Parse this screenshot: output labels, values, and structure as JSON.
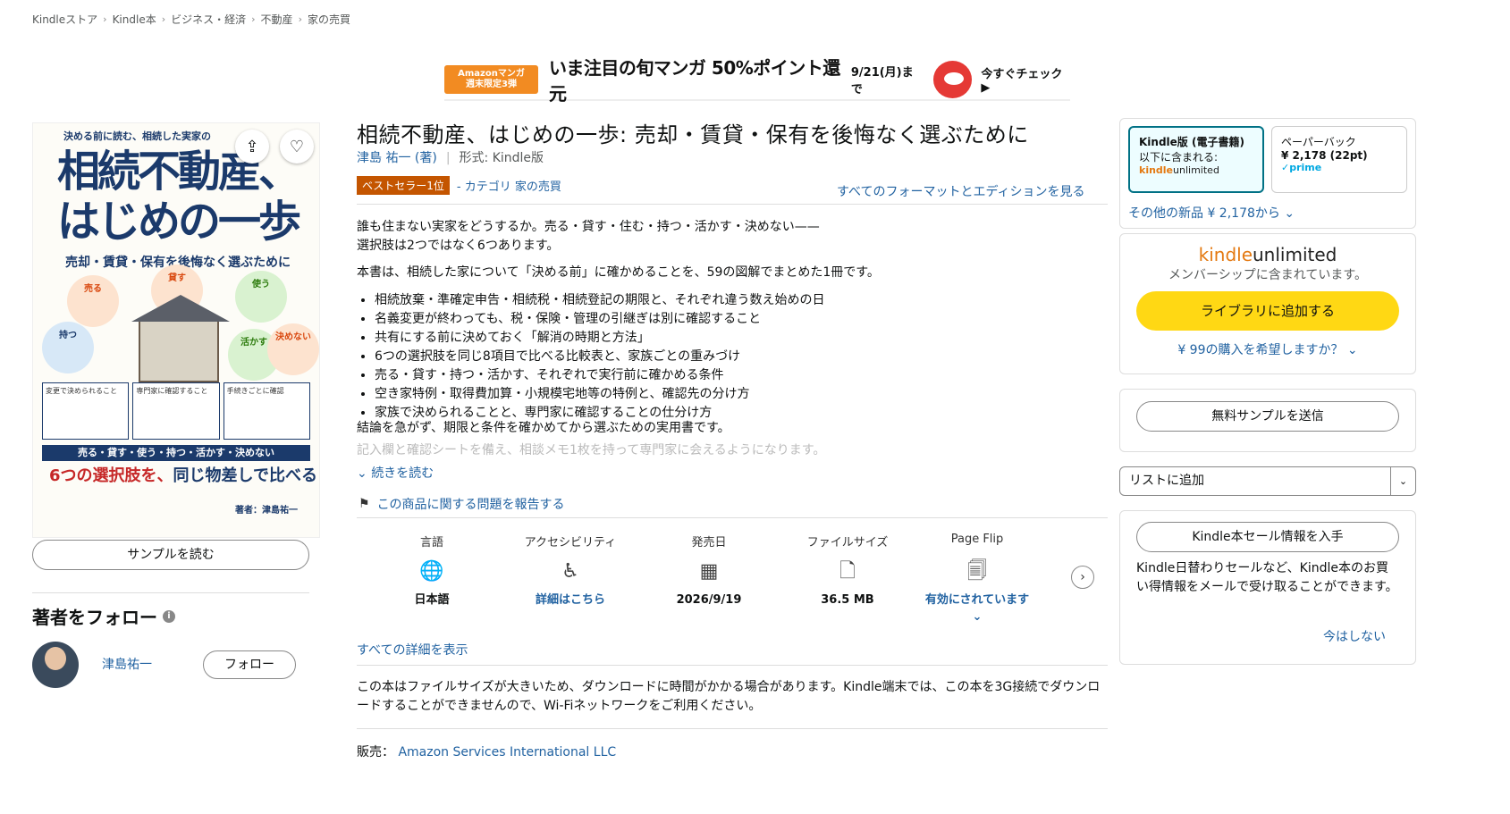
{
  "breadcrumb": [
    "Kindleストア",
    "Kindle本",
    "ビジネス・経済",
    "不動産",
    "家の売買"
  ],
  "banner": {
    "badge": "Amazonマンガ 週末限定3弾",
    "headline": "いま注目の旬マンガ 50%ポイント還元",
    "date": "9/21(月)まで",
    "cta": "今すぐチェック ▶"
  },
  "cover": {
    "top_text": "決める前に読む、相続した実家の",
    "title_line1": "相続不動産、",
    "title_line2": "はじめの一歩",
    "subtitle": "売却・賃貸・保有を後悔なく選ぶために",
    "circles": [
      "売る",
      "貸す",
      "使う",
      "持つ",
      "活かす",
      "決めない"
    ],
    "boxes": [
      "変更で決められること",
      "専門家に確認すること",
      "手続きごとに確認"
    ],
    "band": "売る・貸す・使う・持つ・活かす・決めない",
    "six_red": "6つの選択肢を、",
    "six_blue": "同じ物差しで比べる",
    "author": "著者：津島祐一",
    "share_icon": "share-icon",
    "heart_icon": "heart-icon"
  },
  "left": {
    "sample_button": "サンプルを読む",
    "follow_title": "著者をフォロー",
    "author_name": "津島祐一",
    "follow_button": "フォロー"
  },
  "product": {
    "title": "相続不動産、はじめの一歩: 売却・賃貸・保有を後悔なく選ぶために",
    "author": "津島 祐一 (著)",
    "format": "形式: Kindle版",
    "bestseller": "ベストセラー1位",
    "category": "- カテゴリ 家の売買",
    "all_formats": "すべてのフォーマットとエディションを見る"
  },
  "description": {
    "p1a": "誰も住まない実家をどうするか。売る・貸す・住む・持つ・活かす・決めない——",
    "p1b": "選択肢は2つではなく6つあります。",
    "p2": "本書は、相続した家について「決める前」に確かめることを、59の図解でまとめた1冊です。",
    "bullets": [
      "相続放棄・準確定申告・相続税・相続登記の期限と、それぞれ違う数え始めの日",
      "名義変更が終わっても、税・保険・管理の引継ぎは別に確認すること",
      "共有にする前に決めておく「解消の時期と方法」",
      "6つの選択肢を同じ8項目で比べる比較表と、家族ごとの重みづけ",
      "売る・貸す・持つ・活かす、それぞれで実行前に確かめる条件",
      "空き家特例・取得費加算・小規模宅地等の特例と、確認先の分け方",
      "家族で決められることと、専門家に確認することの仕分け方"
    ],
    "p3": "結論を急がず、期限と条件を確かめてから選ぶための実用書です。",
    "p4": "記入欄と確認シートを備え、相談メモ1枚を持って専門家に会えるようになります。",
    "read_more": "続きを読む"
  },
  "report": "この商品に関する問題を報告する",
  "attributes": [
    {
      "label": "言語",
      "icon": "globe-icon",
      "glyph": "🌐",
      "value": "日本語",
      "link": false
    },
    {
      "label": "アクセシビリティ",
      "icon": "accessibility-icon",
      "glyph": "♿",
      "value": "詳細はこちら",
      "link": true
    },
    {
      "label": "発売日",
      "icon": "calendar-icon",
      "glyph": "▦",
      "value": "2026/9/19",
      "link": false
    },
    {
      "label": "ファイルサイズ",
      "icon": "file-icon",
      "glyph": "🗋",
      "value": "36.5 MB",
      "link": false
    },
    {
      "label": "Page Flip",
      "icon": "page-flip-icon",
      "glyph": "🗐",
      "value": "有効にされています ⌄",
      "link": true
    }
  ],
  "all_details": "すべての詳細を表示",
  "notice": "この本はファイルサイズが大きいため、ダウンロードに時間がかかる場合があります。Kindle端末では、この本を3G接続でダウンロードすることができませんので、Wi-Fiネットワークをご利用ください。",
  "seller": {
    "label": "販売：",
    "name": "Amazon Services International LLC"
  },
  "buybox": {
    "kindle_title": "Kindle版 (電子書籍)",
    "kindle_included": "以下に含まれる:",
    "ku_kindle": "kindle",
    "ku_unlimited": "unlimited",
    "paper_title": "ペーパーバック",
    "paper_price": "¥ 2,178 (22pt)",
    "prime": "✓prime",
    "other_new": "その他の新品 ¥ 2,178から ⌄",
    "ku_member": "メンバーシップに含まれています。",
    "ku_button": "ライブラリに追加する",
    "buy_99": "¥ 99の購入を希望しますか？ ⌄",
    "send_sample": "無料サンプルを送信",
    "list_add": "リストに追加",
    "sale_button": "Kindle本セール情報を入手",
    "sale_text": "Kindle日替わりセールなど、Kindle本のお買い得情報をメールで受け取ることができます。",
    "not_now": "今はしない"
  },
  "colors": {
    "link": "#2162a1",
    "bestseller": "#c45500",
    "ku_button": "#ffd814",
    "kindle_selected": "#007185"
  }
}
